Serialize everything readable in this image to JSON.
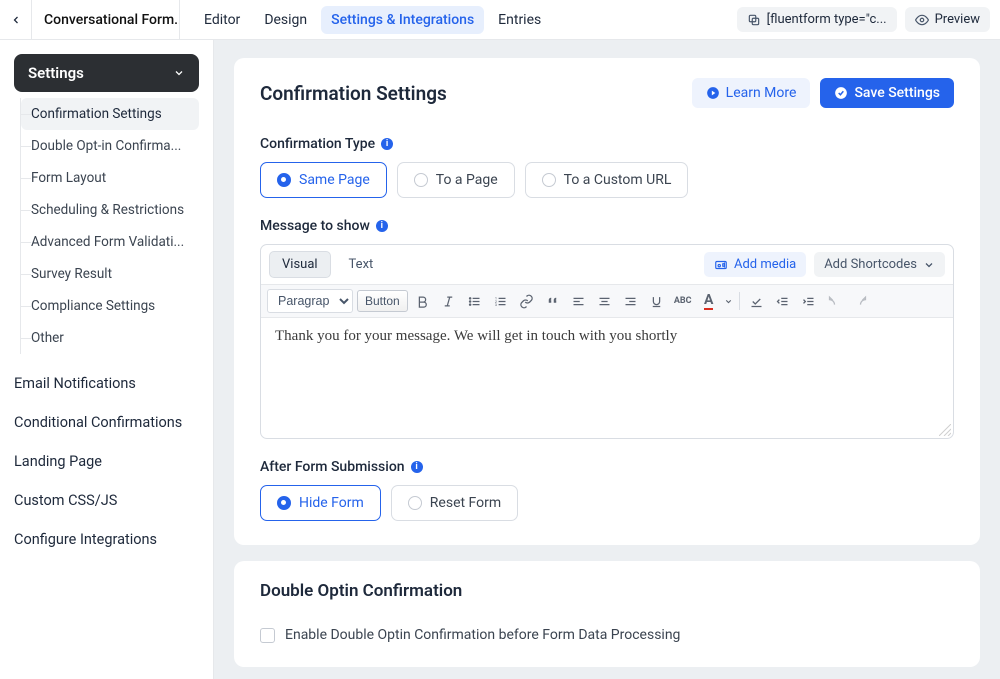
{
  "header": {
    "form_name": "Conversational Form...",
    "tabs": [
      "Editor",
      "Design",
      "Settings & Integrations",
      "Entries"
    ],
    "active_tab_index": 2,
    "shortcode": "[fluentform type=\"c...",
    "preview": "Preview"
  },
  "sidebar": {
    "group_title": "Settings",
    "items": [
      "Confirmation Settings",
      "Double Opt-in Confirma...",
      "Form Layout",
      "Scheduling & Restrictions",
      "Advanced Form Validati...",
      "Survey Result",
      "Compliance Settings",
      "Other"
    ],
    "active_item_index": 0,
    "links": [
      "Email Notifications",
      "Conditional Confirmations",
      "Landing Page",
      "Custom CSS/JS",
      "Configure Integrations"
    ]
  },
  "confirmation": {
    "title": "Confirmation Settings",
    "learn_more": "Learn More",
    "save": "Save Settings",
    "type_label": "Confirmation Type",
    "type_options": [
      "Same Page",
      "To a Page",
      "To a Custom URL"
    ],
    "type_selected_index": 0,
    "message_label": "Message to show",
    "editor": {
      "tabs": [
        "Visual",
        "Text"
      ],
      "active_tab_index": 0,
      "add_media": "Add media",
      "add_shortcodes": "Add Shortcodes",
      "format_select": "Paragraph",
      "button_tool": "Button",
      "content": "Thank you for your message. We will get in touch with you shortly"
    },
    "after_label": "After Form Submission",
    "after_options": [
      "Hide Form",
      "Reset Form"
    ],
    "after_selected_index": 0
  },
  "double_optin": {
    "title": "Double Optin Confirmation",
    "checkbox_label": "Enable Double Optin Confirmation before Form Data Processing"
  }
}
